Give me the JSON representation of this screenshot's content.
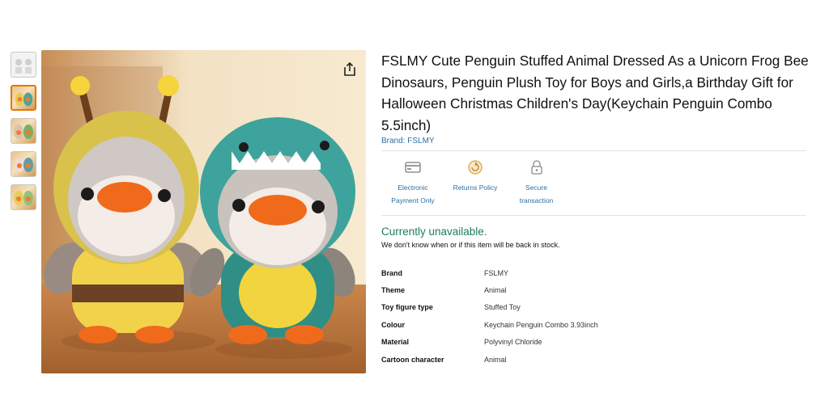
{
  "product": {
    "title": "FSLMY Cute Penguin Stuffed Animal Dressed As a Unicorn Frog Bee Dinosaurs, Penguin Plush Toy for Boys and Girls,a Birthday Gift for Halloween Christmas Children's Day(Keychain Penguin Combo 5.5inch)",
    "brand_link": "Brand: FSLMY"
  },
  "thumbnails": [
    {
      "icon": "product-thumbnail"
    },
    {
      "icon": "product-thumbnail"
    },
    {
      "icon": "product-thumbnail"
    },
    {
      "icon": "product-thumbnail"
    },
    {
      "icon": "product-thumbnail"
    }
  ],
  "share": {
    "icon": "share-icon"
  },
  "badges": [
    {
      "label_line1": "Electronic",
      "label_line2": "Payment Only",
      "icon": "payment-card-icon"
    },
    {
      "label_line1": "Returns Policy",
      "label_line2": "",
      "icon": "returns-icon"
    },
    {
      "label_line1": "Secure",
      "label_line2": "transaction",
      "icon": "lock-icon"
    }
  ],
  "availability": {
    "status": "Currently unavailable.",
    "note": "We don't know when or if this item will be back in stock."
  },
  "specs": [
    {
      "key": "Brand",
      "value": "FSLMY"
    },
    {
      "key": "Theme",
      "value": "Animal"
    },
    {
      "key": "Toy figure type",
      "value": "Stuffed Toy"
    },
    {
      "key": "Colour",
      "value": "Keychain Penguin Combo 3.93inch"
    },
    {
      "key": "Material",
      "value": "Polyvinyl Chloride"
    },
    {
      "key": "Cartoon character",
      "value": "Animal"
    }
  ],
  "colors": {
    "link": "#2d6fa3",
    "availability": "#1c7e5a",
    "thumb_active_border": "#e77600"
  }
}
